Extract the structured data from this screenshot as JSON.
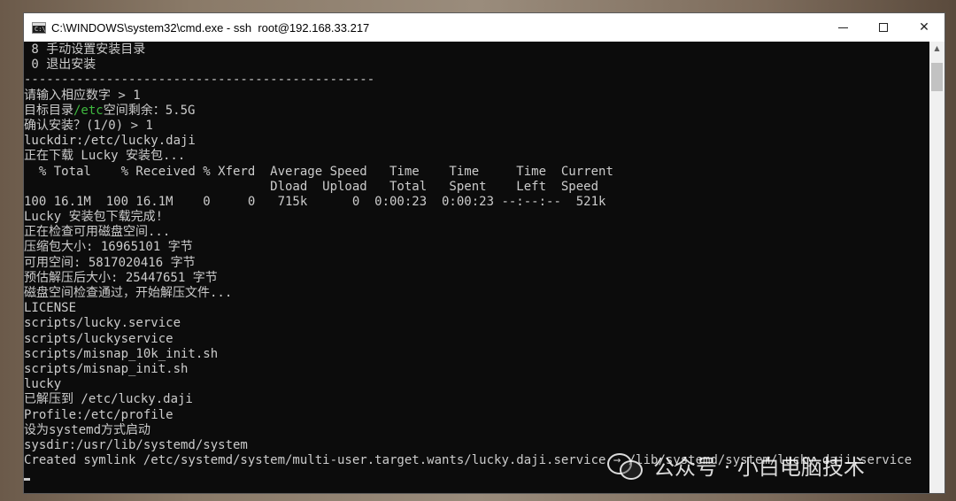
{
  "window": {
    "title": "C:\\WINDOWS\\system32\\cmd.exe - ssh  root@192.168.33.217",
    "app_icon": "cmd-icon",
    "controls": {
      "minimize": "─",
      "maximize": "☐",
      "close": "✕"
    }
  },
  "console": {
    "lines": [
      " 8 手动设置安装目录",
      " 0 退出安装",
      "-----------------------------------------------",
      "请输入相应数字 > 1",
      "确认安装？(1/0) > 1",
      "luckdir:/etc/lucky.daji",
      "正在下载 Lucky 安装包...",
      "  % Total    % Received % Xferd  Average Speed   Time    Time     Time  Current",
      "                                 Dload  Upload   Total   Spent    Left  Speed",
      "100 16.1M  100 16.1M    0     0   715k      0  0:00:23  0:00:23 --:--:--  521k",
      "Lucky 安装包下载完成!",
      "正在检查可用磁盘空间...",
      "压缩包大小: 16965101 字节",
      "可用空间: 5817020416 字节",
      "预估解压后大小: 25447651 字节",
      "磁盘空间检查通过，开始解压文件...",
      "LICENSE",
      "scripts/lucky.service",
      "scripts/luckyservice",
      "scripts/misnap_10k_init.sh",
      "scripts/misnap_init.sh",
      "lucky",
      "已解压到 /etc/lucky.daji",
      "Profile:/etc/profile",
      "设为systemd方式启动",
      "sysdir:/usr/lib/systemd/system",
      "Created symlink /etc/systemd/system/multi-user.target.wants/lucky.daji.service → /lib/systemd/system/lucky.daji.service"
    ],
    "target_line": {
      "prefix": "目标目录",
      "path": "/etc",
      "suffix": "空间剩余：5.5G",
      "path_color": "#3fb93f"
    }
  },
  "watermark": {
    "icon": "wechat-icon",
    "text": "公众号 · 小白电脑技术"
  }
}
